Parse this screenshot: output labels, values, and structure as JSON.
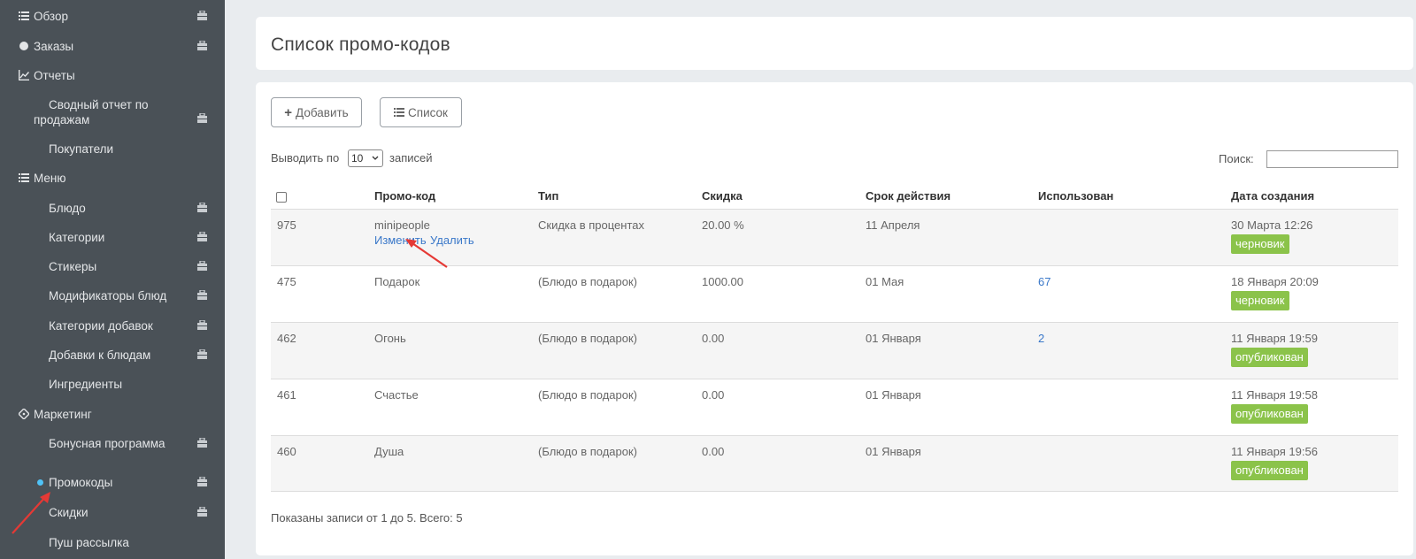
{
  "sidebar": {
    "items": [
      {
        "label": "Обзор"
      },
      {
        "label": "Заказы"
      },
      {
        "label": "Отчеты"
      },
      {
        "label": "Сводный отчет по",
        "label2": "продажам"
      },
      {
        "label": "Покупатели"
      },
      {
        "label": "Меню"
      },
      {
        "label": "Блюдо"
      },
      {
        "label": "Категории"
      },
      {
        "label": "Стикеры"
      },
      {
        "label": "Модификаторы блюд"
      },
      {
        "label": "Категории добавок"
      },
      {
        "label": "Добавки к блюдам"
      },
      {
        "label": "Ингредиенты"
      },
      {
        "label": "Маркетинг"
      },
      {
        "label": "Бонусная программа"
      },
      {
        "label": "Промокоды"
      },
      {
        "label": "Скидки"
      },
      {
        "label": "Пуш рассылка"
      }
    ]
  },
  "page": {
    "title": "Список промо-кодов"
  },
  "toolbar": {
    "add_label": "Добавить",
    "list_label": "Список"
  },
  "length": {
    "prefix": "Выводить по",
    "value": "10",
    "suffix": "записей"
  },
  "search": {
    "label": "Поиск:",
    "value": ""
  },
  "table": {
    "headers": [
      "Промо-код",
      "Тип",
      "Скидка",
      "Срок действия",
      "Использован",
      "Дата создания"
    ],
    "rows": [
      {
        "id": "975",
        "code": "minipeople",
        "edit": "Изменить",
        "delete": "Удалить",
        "type": "Скидка в процентах",
        "discount": "20.00 %",
        "valid": "11 Апреля",
        "used": "",
        "created": "30 Марта 12:26",
        "status": "черновик"
      },
      {
        "id": "475",
        "code": "Подарок",
        "type": "(Блюдо в подарок)",
        "discount": "1000.00",
        "valid": "01 Мая",
        "used": "67",
        "created": "18 Января 20:09",
        "status": "черновик"
      },
      {
        "id": "462",
        "code": "Огонь",
        "type": "(Блюдо в подарок)",
        "discount": "0.00",
        "valid": "01 Января",
        "used": "2",
        "created": "11 Января 19:59",
        "status": "опубликован"
      },
      {
        "id": "461",
        "code": "Счастье",
        "type": "(Блюдо в подарок)",
        "discount": "0.00",
        "valid": "01 Января",
        "used": "",
        "created": "11 Января 19:58",
        "status": "опубликован"
      },
      {
        "id": "460",
        "code": "Душа",
        "type": "(Блюдо в подарок)",
        "discount": "0.00",
        "valid": "01 Января",
        "used": "",
        "created": "11 Января 19:56",
        "status": "опубликован"
      }
    ]
  },
  "footer": {
    "info": "Показаны записи от 1 до 5. Всего: 5"
  },
  "colors": {
    "sidebar_bg": "#4a5157",
    "badge": "#8bc34a",
    "link": "#3a78c9",
    "annotation": "#e53935"
  }
}
